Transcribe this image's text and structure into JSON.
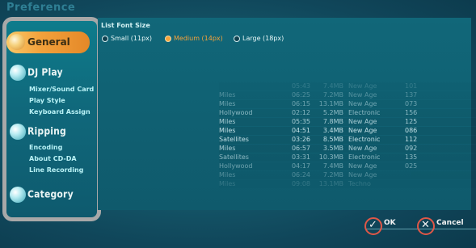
{
  "window": {
    "title": "Preference"
  },
  "sidebar": {
    "sections": [
      {
        "label": "General",
        "active": true,
        "items": []
      },
      {
        "label": "DJ Play",
        "items": [
          "Mixer/Sound Card",
          "Play Style",
          "Keyboard Assign"
        ]
      },
      {
        "label": "Ripping",
        "items": [
          "Encoding",
          "About CD-DA",
          "Line Recording"
        ]
      },
      {
        "label": "Category",
        "items": []
      }
    ]
  },
  "font_size": {
    "title": "List Font Size",
    "options": [
      {
        "label": "Small (11px)",
        "selected": false
      },
      {
        "label": "Medium (14px)",
        "selected": true
      },
      {
        "label": "Large (18px)",
        "selected": false
      }
    ]
  },
  "preview_table": {
    "rows": [
      [
        "",
        "05:43",
        "7.4MB",
        "New Age",
        "101"
      ],
      [
        "Miles",
        "06:25",
        "7.2MB",
        "New Age",
        "137"
      ],
      [
        "Miles",
        "06:15",
        "13.1MB",
        "New Age",
        "073"
      ],
      [
        "Hollywood",
        "02:12",
        "5.2MB",
        "Electronic",
        "156"
      ],
      [
        "Miles",
        "05:35",
        "7.8MB",
        "New Age",
        "125"
      ],
      [
        "Miles",
        "04:51",
        "3.4MB",
        "New Age",
        "086"
      ],
      [
        "Satellites",
        "03:26",
        "8.5MB",
        "Electronic",
        "112"
      ],
      [
        "Miles",
        "06:57",
        "3.5MB",
        "New Age",
        "092"
      ],
      [
        "Satellites",
        "03:31",
        "10.3MB",
        "Electronic",
        "135"
      ],
      [
        "Hollywood",
        "04:17",
        "7.4MB",
        "New Age",
        "025"
      ],
      [
        "Miles",
        "06:24",
        "7.2MB",
        "New Age",
        ""
      ],
      [
        "Miles",
        "09:08",
        "13.1MB",
        "Techno",
        ""
      ]
    ]
  },
  "buttons": {
    "ok": "OK",
    "cancel": "Cancel"
  },
  "colors": {
    "accent": "#f7a33a",
    "cancel": "#e05747",
    "background": "#155b6d"
  }
}
